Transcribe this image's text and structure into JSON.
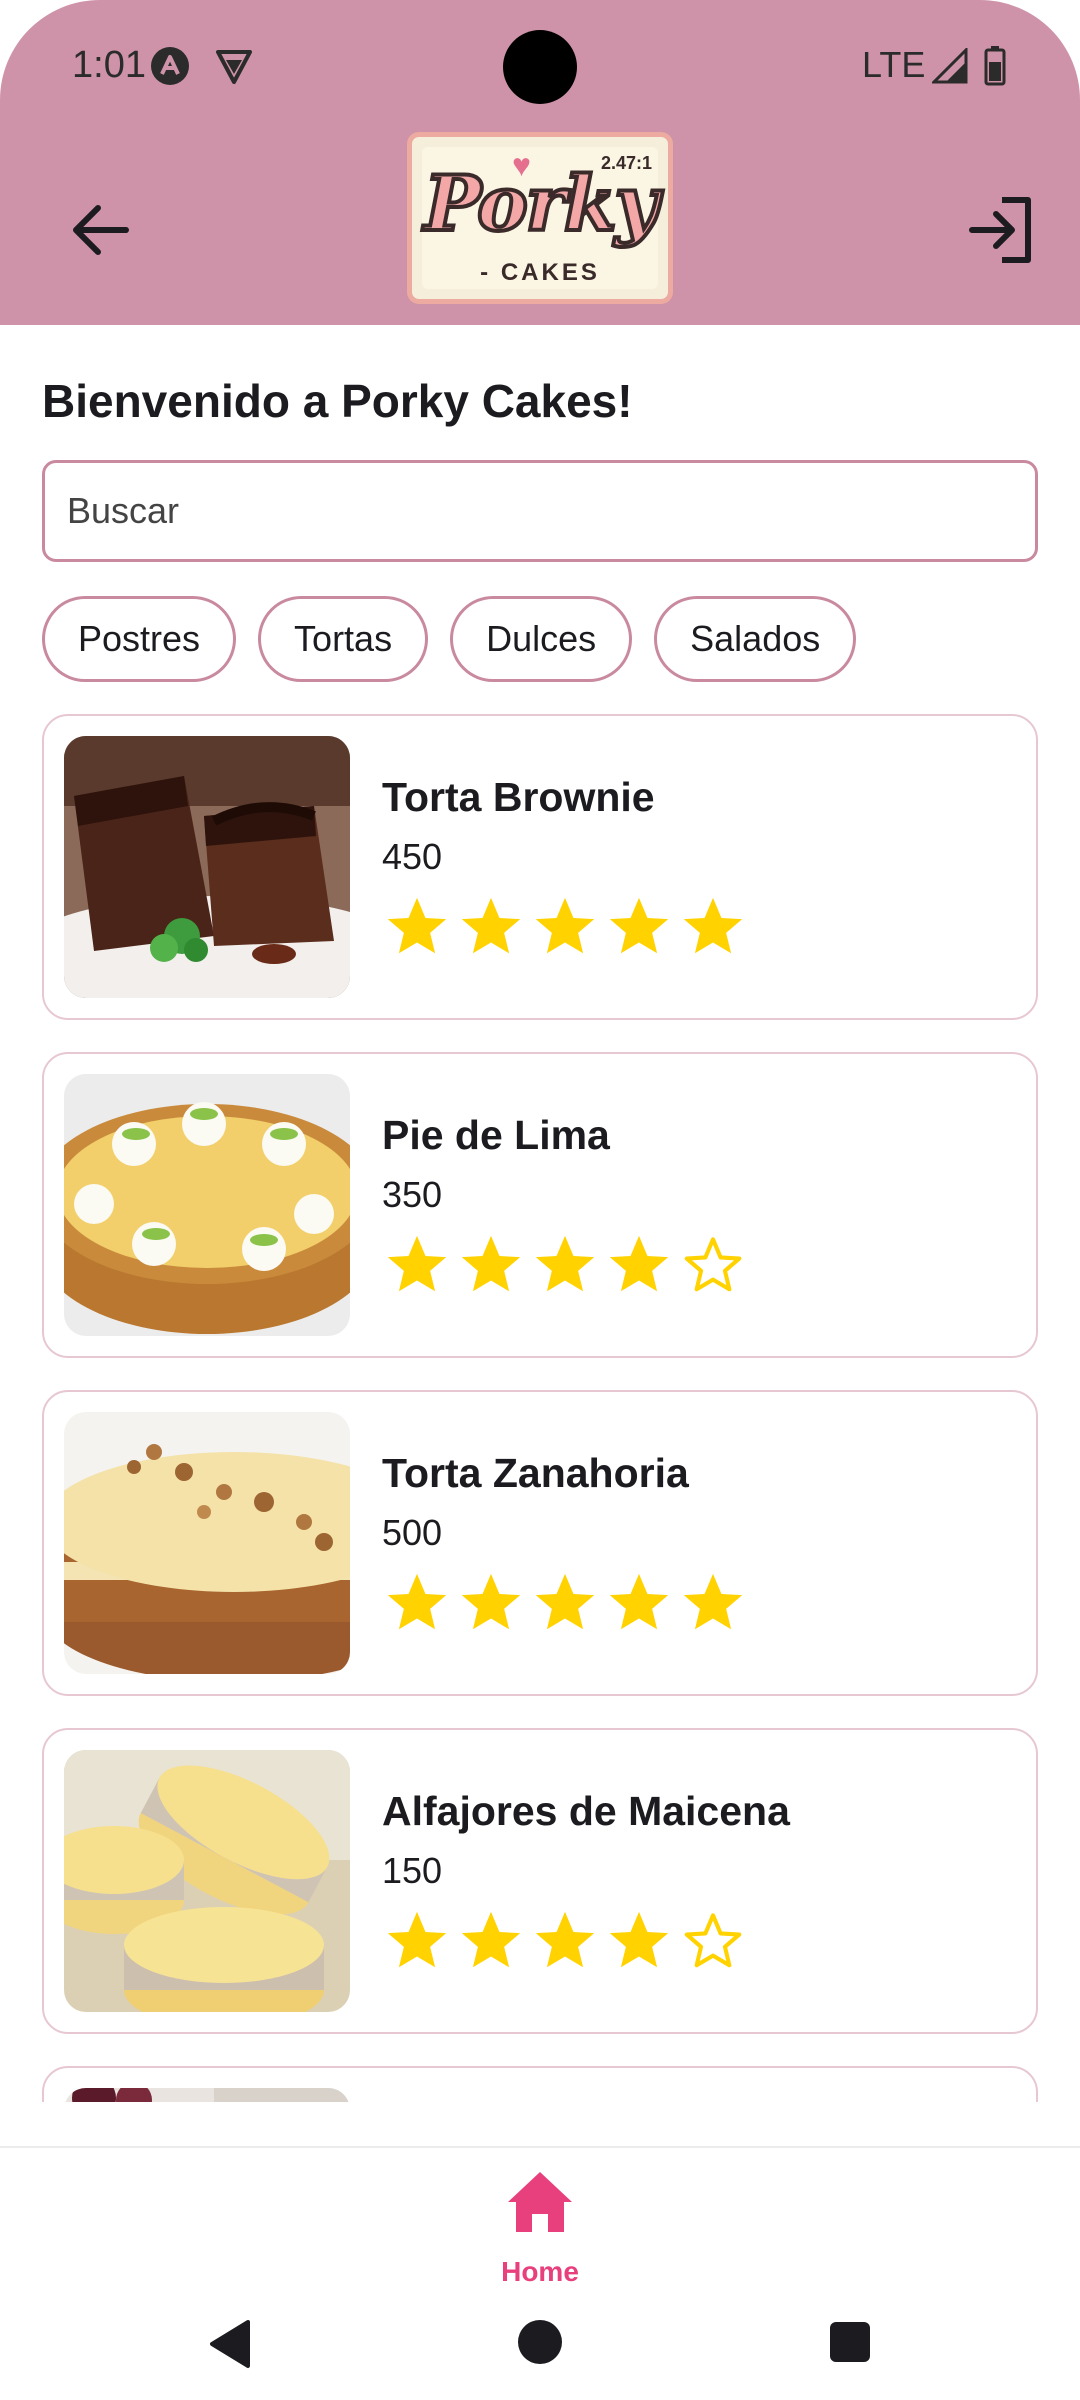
{
  "status_bar": {
    "time": "1:01",
    "network": "LTE"
  },
  "app_bar": {
    "logo": {
      "word": "Porky",
      "sub": "- CAKES",
      "version": "2.47:1"
    }
  },
  "main": {
    "welcome": "Bienvenido a Porky Cakes!",
    "search_placeholder": "Buscar",
    "chips": [
      "Postres",
      "Tortas",
      "Dulces",
      "Salados"
    ],
    "products": [
      {
        "name": "Torta Brownie",
        "price": "450",
        "rating": 5,
        "max_rating": 5
      },
      {
        "name": "Pie de Lima",
        "price": "350",
        "rating": 4,
        "max_rating": 5
      },
      {
        "name": "Torta Zanahoria",
        "price": "500",
        "rating": 5,
        "max_rating": 5
      },
      {
        "name": "Alfajores de Maicena",
        "price": "150",
        "rating": 4,
        "max_rating": 5
      }
    ]
  },
  "bottom_nav": {
    "home_label": "Home"
  },
  "colors": {
    "app_bar": "#cf93a9",
    "accent": "#e8407d",
    "star": "#ffd200",
    "outline": "#c98aa0"
  }
}
